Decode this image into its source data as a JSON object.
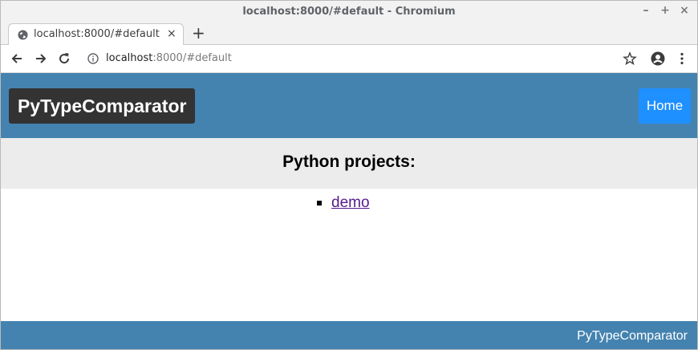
{
  "window": {
    "title": "localhost:8000/#default - Chromium",
    "controls": {
      "minimize": "–",
      "maximize": "+",
      "close": "×"
    }
  },
  "tab": {
    "title": "localhost:8000/#default",
    "close": "×",
    "new_tab": "+",
    "favicon": "globe-icon"
  },
  "toolbar": {
    "url_host": "localhost",
    "url_path": ":8000/#default",
    "icons": [
      "back-arrow-icon",
      "forward-arrow-icon",
      "reload-icon",
      "info-icon",
      "star-icon",
      "account-icon",
      "menu-dots-icon"
    ]
  },
  "navbar": {
    "brand": "PyTypeComparator",
    "home": "Home",
    "color": "#4483b0",
    "home_color": "#1e90ff"
  },
  "main": {
    "heading": "Python projects:",
    "projects": [
      {
        "label": "demo"
      }
    ]
  },
  "footer": {
    "text": "PyTypeComparator"
  }
}
